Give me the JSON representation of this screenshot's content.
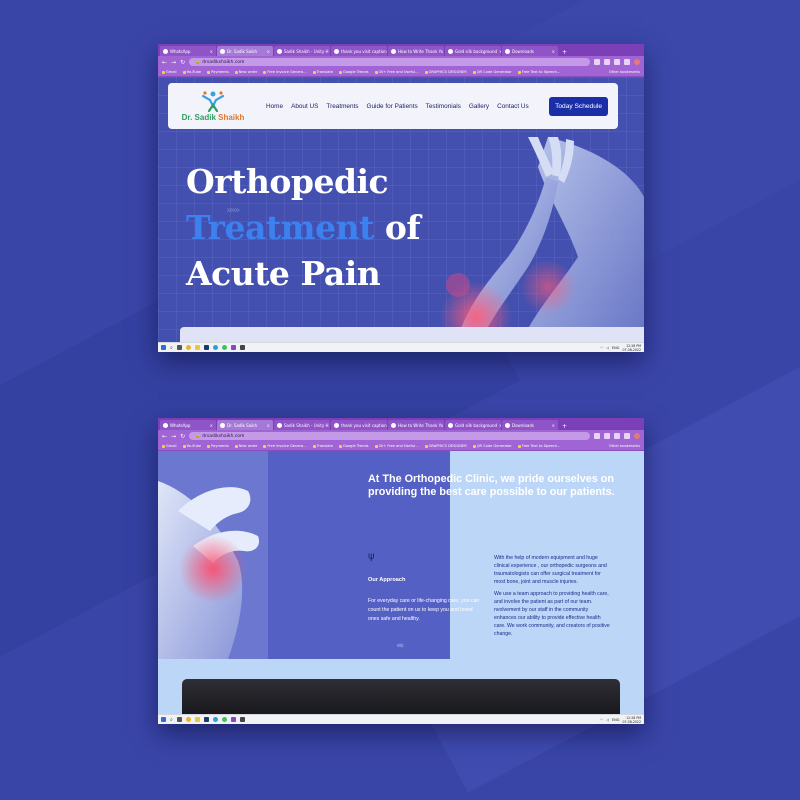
{
  "browser": {
    "tabs_top": [
      {
        "label": "WhatsApp",
        "active": false
      },
      {
        "label": "Dr. Sadik Saikh",
        "active": true
      },
      {
        "label": "Sadik Shaikh - Unity H",
        "active": false
      },
      {
        "label": "thank you visit caption",
        "active": false
      },
      {
        "label": "How to Write Thank Yo",
        "active": false
      },
      {
        "label": "Gold silk background",
        "active": false
      },
      {
        "label": "Downloads",
        "active": false
      }
    ],
    "tabs_bottom": [
      {
        "label": "WhatsApp",
        "active": false
      },
      {
        "label": "Dr. Sadik Saikh",
        "active": true
      },
      {
        "label": "Sadik Shaikh - Unity H",
        "active": false
      },
      {
        "label": "thank you visit caption",
        "active": false
      },
      {
        "label": "How to Write Thank Yo",
        "active": false
      },
      {
        "label": "Gold silk background",
        "active": false
      },
      {
        "label": "Downloads",
        "active": false
      }
    ],
    "url": "drsadikshaikh.com",
    "bookmarks": [
      "Gmail",
      "YouTube",
      "Payments",
      "New order",
      "Free Invoice Genera...",
      "Translate",
      "Google Trends",
      "30+ Free and Useful...",
      "GRAPHICS DESIGNER",
      "QR Code Generator",
      "Free Text to Speech..."
    ],
    "other_bookmarks": "Other bookmarks"
  },
  "site": {
    "logo": {
      "dr": "Dr.",
      "first": "Sadik",
      "last": "Shaikh"
    },
    "nav": [
      "Home",
      "About US",
      "Treatments",
      "Guide for Patients",
      "Testimonials",
      "Gallery",
      "Contact Us"
    ],
    "cta": "Today Schedule",
    "hero": {
      "line1": "Orthopedic",
      "highlight": "Treatment",
      "line2_rest": "of",
      "line3": "Acute Pain"
    }
  },
  "section2": {
    "heading": "At The Orthopedic Clinic, we pride ourselves on providing the best care possible to our patients.",
    "approach_title": "Our Approach",
    "approach_text": "For everyday care or life-changing care, you can count the patient on us to keep you and loved ones safe and healthy.",
    "right_p1": "With the help of modern equipment and huge clinical experience , our orthopedic surgeons and traumatologists can offer surgical treatment for most bone, joint and muscle injuries.",
    "right_p2": "We use a team approach to providing health care, and involve the patient as part of our team. nvolvement by our staff in the community enhances our ability to provide effective health care. We work community, and creators of positive change."
  },
  "taskbar": {
    "time": "12:28 PM",
    "date": "07-08-2022",
    "lang": "ENG"
  },
  "colors": {
    "background": "#3a45a8",
    "hero_bg": "#4350b0",
    "accent_blue": "#3b82f0",
    "cta": "#1a2ea8",
    "chrome": "#a064d4"
  }
}
